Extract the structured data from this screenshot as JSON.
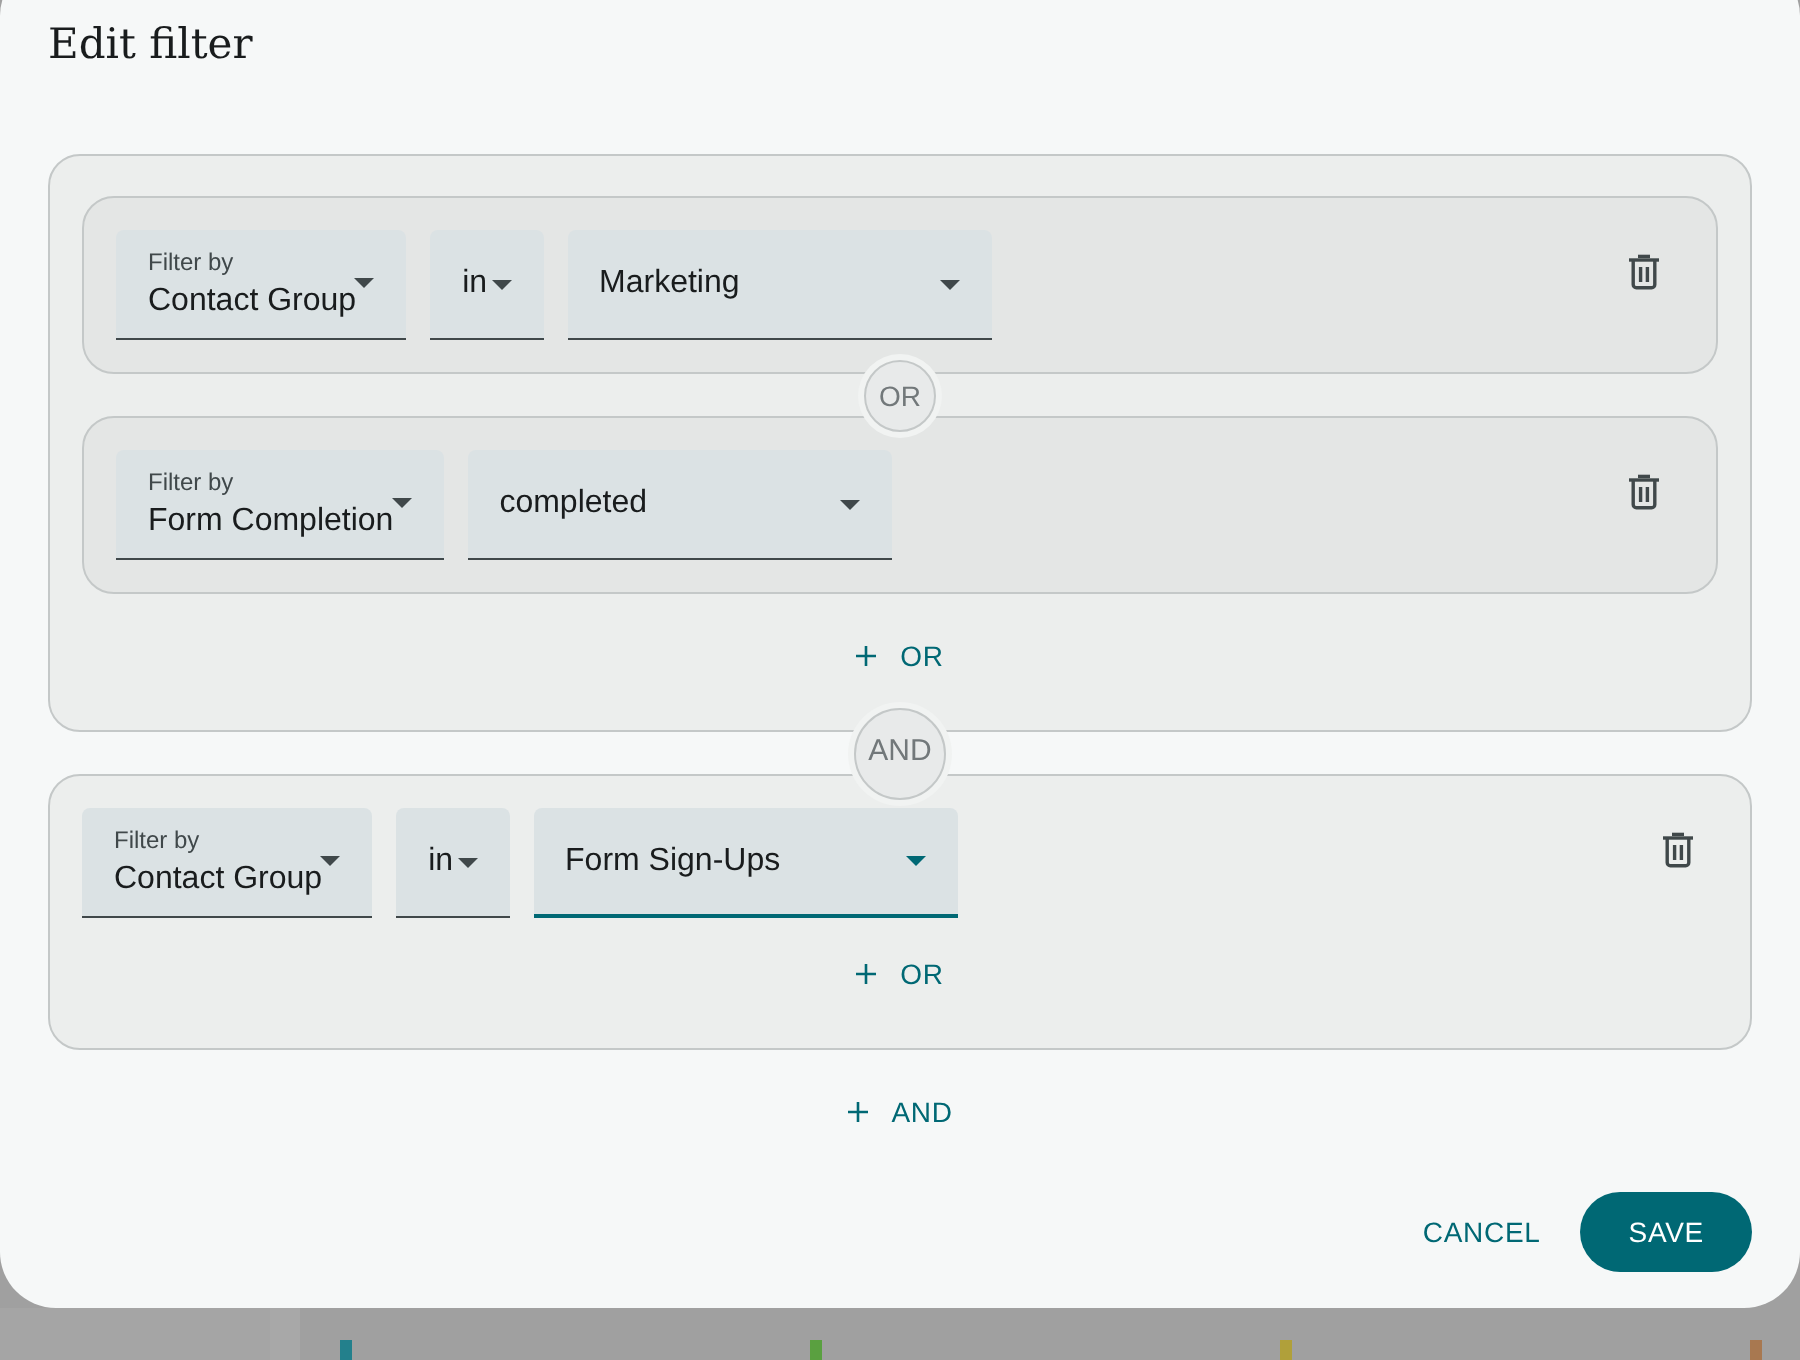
{
  "dialog": {
    "title": "Edit filter"
  },
  "groups": [
    {
      "conditions": [
        {
          "fields": [
            {
              "kind": "attribute",
              "label": "Filter by",
              "value": "Contact Group",
              "focused": false
            },
            {
              "kind": "operator",
              "value": "in",
              "focused": false
            },
            {
              "kind": "value",
              "value": "Marketing",
              "focused": false
            }
          ]
        },
        {
          "fields": [
            {
              "kind": "attribute",
              "label": "Filter by",
              "value": "Form Completion",
              "focused": false
            },
            {
              "kind": "value",
              "value": "completed",
              "focused": false
            }
          ]
        }
      ],
      "joiners": [
        "OR"
      ],
      "add_button": {
        "label": "OR"
      }
    },
    {
      "conditions": [
        {
          "fields": [
            {
              "kind": "attribute",
              "label": "Filter by",
              "value": "Contact Group",
              "focused": false
            },
            {
              "kind": "operator",
              "value": "in",
              "focused": false
            },
            {
              "kind": "value",
              "value": "Form Sign-Ups",
              "focused": true
            }
          ]
        }
      ],
      "add_button": {
        "label": "OR"
      }
    }
  ],
  "group_joiners": [
    "AND"
  ],
  "add_group_button": {
    "label": "AND"
  },
  "actions": [
    {
      "kind": "text",
      "label": "CANCEL"
    },
    {
      "kind": "filled",
      "label": "SAVE"
    }
  ],
  "backdrop": {
    "bars": [
      {
        "color": "#23808c"
      },
      {
        "color": "#5aa040"
      },
      {
        "color": "#b0a03a"
      },
      {
        "color": "#a87850"
      }
    ]
  }
}
